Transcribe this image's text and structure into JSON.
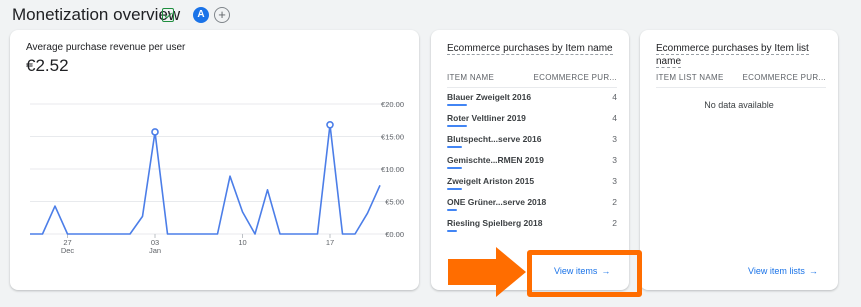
{
  "header": {
    "title": "Monetization overview",
    "avatar_letter": "A",
    "add_symbol": "+"
  },
  "revenue_card": {
    "label": "Average purchase revenue per user",
    "value": "€2.52",
    "chart_data": {
      "type": "line",
      "x_ticks": [
        {
          "day": "27",
          "month": "Dec"
        },
        {
          "day": "03",
          "month": "Jan"
        },
        {
          "day": "10",
          "month": ""
        },
        {
          "day": "17",
          "month": ""
        }
      ],
      "y_ticks": [
        "€20.00",
        "€15.00",
        "€10.00",
        "€5.00",
        "€0.00"
      ],
      "ylim": [
        0,
        20
      ],
      "series": [
        {
          "values": [
            0,
            0,
            4.3,
            0,
            0,
            0,
            0,
            0,
            0,
            2.7,
            15.7,
            0,
            0,
            0,
            0,
            0,
            8.9,
            3.4,
            0,
            6.8,
            0,
            0,
            0,
            0,
            16.8,
            0,
            0,
            3.2,
            7.5
          ],
          "markers": [
            10,
            24
          ]
        }
      ],
      "color": "#4c7ee8",
      "grid": true
    }
  },
  "items_card": {
    "title_line1": "Ecommerce purchases by Item name",
    "col_left": "ITEM NAME",
    "col_right": "ECOMMERCE PUR...",
    "rows": [
      {
        "name": "Blauer Zweigelt 2016",
        "count": "4",
        "share": 1.0
      },
      {
        "name": "Roter Veltliner 2019",
        "count": "4",
        "share": 1.0
      },
      {
        "name": "Blutspecht...serve 2016",
        "count": "3",
        "share": 0.75
      },
      {
        "name": "Gemischte...RMEN 2019",
        "count": "3",
        "share": 0.75
      },
      {
        "name": "Zweigelt Ariston 2015",
        "count": "3",
        "share": 0.75
      },
      {
        "name": "ONE Grüner...serve 2018",
        "count": "2",
        "share": 0.5
      },
      {
        "name": "Riesling Spielberg 2018",
        "count": "2",
        "share": 0.5
      }
    ],
    "link": "View items"
  },
  "lists_card": {
    "title_line1": "Ecommerce purchases by Item list",
    "title_line2": "name",
    "col_left": "ITEM LIST NAME",
    "col_right": "ECOMMERCE PUR...",
    "empty_text": "No data available",
    "link": "View item lists"
  },
  "colors": {
    "accent": "#1a73e8",
    "series": "#4c7ee8",
    "highlight": "#ff6d00"
  }
}
